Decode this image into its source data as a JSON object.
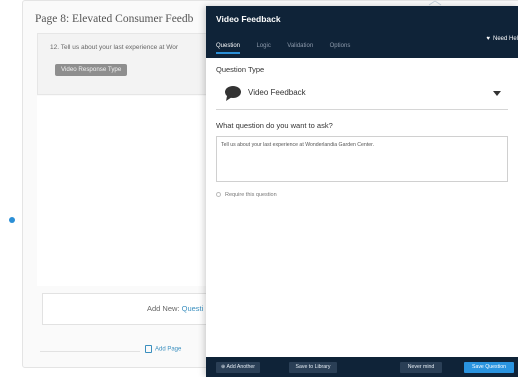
{
  "page": {
    "title": "Page 8: Elevated Consumer Feedb",
    "question_text": "12. Tell us about your last experience at Wor",
    "response_badge": "Video Response Type",
    "add_new_label": "Add New:",
    "add_new_link": "Questi",
    "add_page": "Add Page"
  },
  "modal": {
    "title": "Video Feedback",
    "tabs": [
      {
        "label": "Question",
        "active": true
      },
      {
        "label": "Logic"
      },
      {
        "label": "Validation"
      },
      {
        "label": "Options"
      }
    ],
    "need_help": "Need Hel",
    "question_type_label": "Question Type",
    "question_type_value": "Video Feedback",
    "ask_label": "What question do you want to ask?",
    "ask_value": "Tell us about your last experience at Wonderlandia Garden Center.",
    "require_label": "Require this question",
    "footer": {
      "add_another": "⊕ Add Another",
      "save_library": "Save to Library",
      "cancel": "Never mind",
      "save": "Save Question"
    }
  },
  "colors": {
    "modal_header": "#0f2338",
    "accent_blue": "#2a94e0",
    "badge_grey": "#8e8e8e"
  },
  "icons": [
    "speech-bubble-icon",
    "chevron-down-icon",
    "heart-icon",
    "add-page-icon"
  ]
}
